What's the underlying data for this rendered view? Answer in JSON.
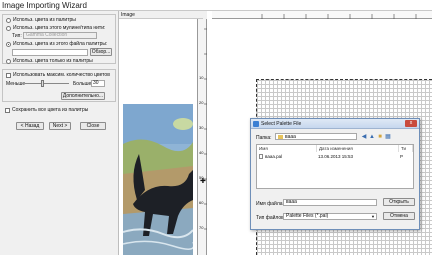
{
  "window": {
    "title": "Image Importing Wizard"
  },
  "left": {
    "group1": {
      "opt_thread_type": "Использ. цвета из палитры",
      "opt_thread_type2": "Использ. цвета этого мулине/типа нити:",
      "type_label": "Тип:",
      "type_value": "Gamma Collection",
      "opt_palette_file": "Использ. цвета из этого файла палитры:",
      "browse_button": "Обзор...",
      "opt_palette_only": "Использ. цвета только из палитры"
    },
    "group2": {
      "max_colors_check": "Использовать максим. количество цветов",
      "less_label": "Меньше",
      "more_label": "Больше",
      "count_value": "30",
      "extra_button": "Дополнительно..."
    },
    "save_colors_check": "Сохранить все цвета из палитры",
    "buttons": {
      "back": "< Назад",
      "next": "Next >",
      "close": "Close"
    }
  },
  "image_panel": {
    "label": "Image"
  },
  "dialog": {
    "title": "Select Palette File",
    "close_glyph": "x",
    "folder_label": "Папка:",
    "folder_value": "вааа",
    "columns": {
      "name": "Имя",
      "date": "Дата изменения",
      "type": "Ти"
    },
    "files": [
      {
        "name": "вааа.pal",
        "date": "13.06.2013 15:53",
        "type": "P"
      }
    ],
    "filename_label": "Имя файла:",
    "filename_value": "вааа",
    "filetype_label": "Тип файлов:",
    "filetype_value": "Palette Files (*.pal)",
    "open_button": "Открыть",
    "cancel_button": "Отмена"
  },
  "rulers": {
    "left_numbers": [
      "10",
      "20",
      "30",
      "40",
      "50",
      "60",
      "70"
    ]
  },
  "colors": {
    "dialog_border": "#6f8fb8",
    "selection": "#cde3f7"
  }
}
